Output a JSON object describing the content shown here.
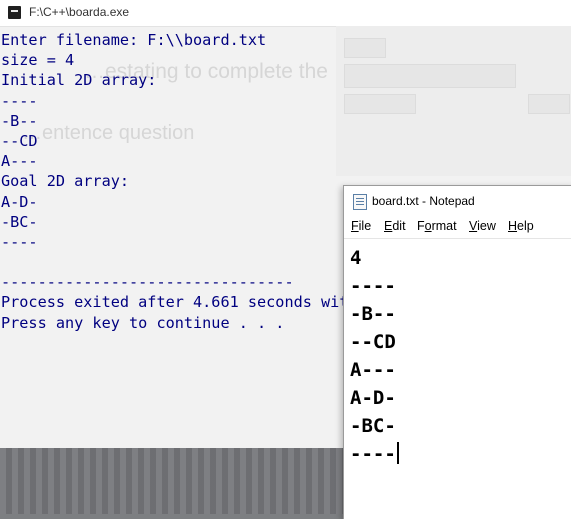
{
  "console": {
    "title": "F:\\C++\\boarda.exe",
    "lines": [
      "Enter filename: F:\\\\board.txt",
      "size = 4",
      "Initial 2D array:",
      "----",
      "-B--",
      "--CD",
      "A---",
      "Goal 2D array:",
      "A-D-",
      "-BC-",
      "----",
      "",
      "--------------------------------",
      "Process exited after 4.661 seconds wit",
      "Press any key to continue . . ."
    ],
    "text_color": "#000080"
  },
  "notepad": {
    "title": "board.txt - Notepad",
    "menu": [
      {
        "key": "F",
        "rest": "ile"
      },
      {
        "key": "E",
        "rest": "dit"
      },
      {
        "key": "F",
        "rest": "ormat",
        "pre": ""
      },
      {
        "key": "V",
        "rest": "iew"
      },
      {
        "key": "H",
        "rest": "elp"
      }
    ],
    "menu_labels": [
      "File",
      "Edit",
      "Format",
      "View",
      "Help"
    ],
    "content": [
      "4",
      "----",
      "-B--",
      "--CD",
      "A---",
      "A-D-",
      "-BC-",
      "----"
    ]
  }
}
